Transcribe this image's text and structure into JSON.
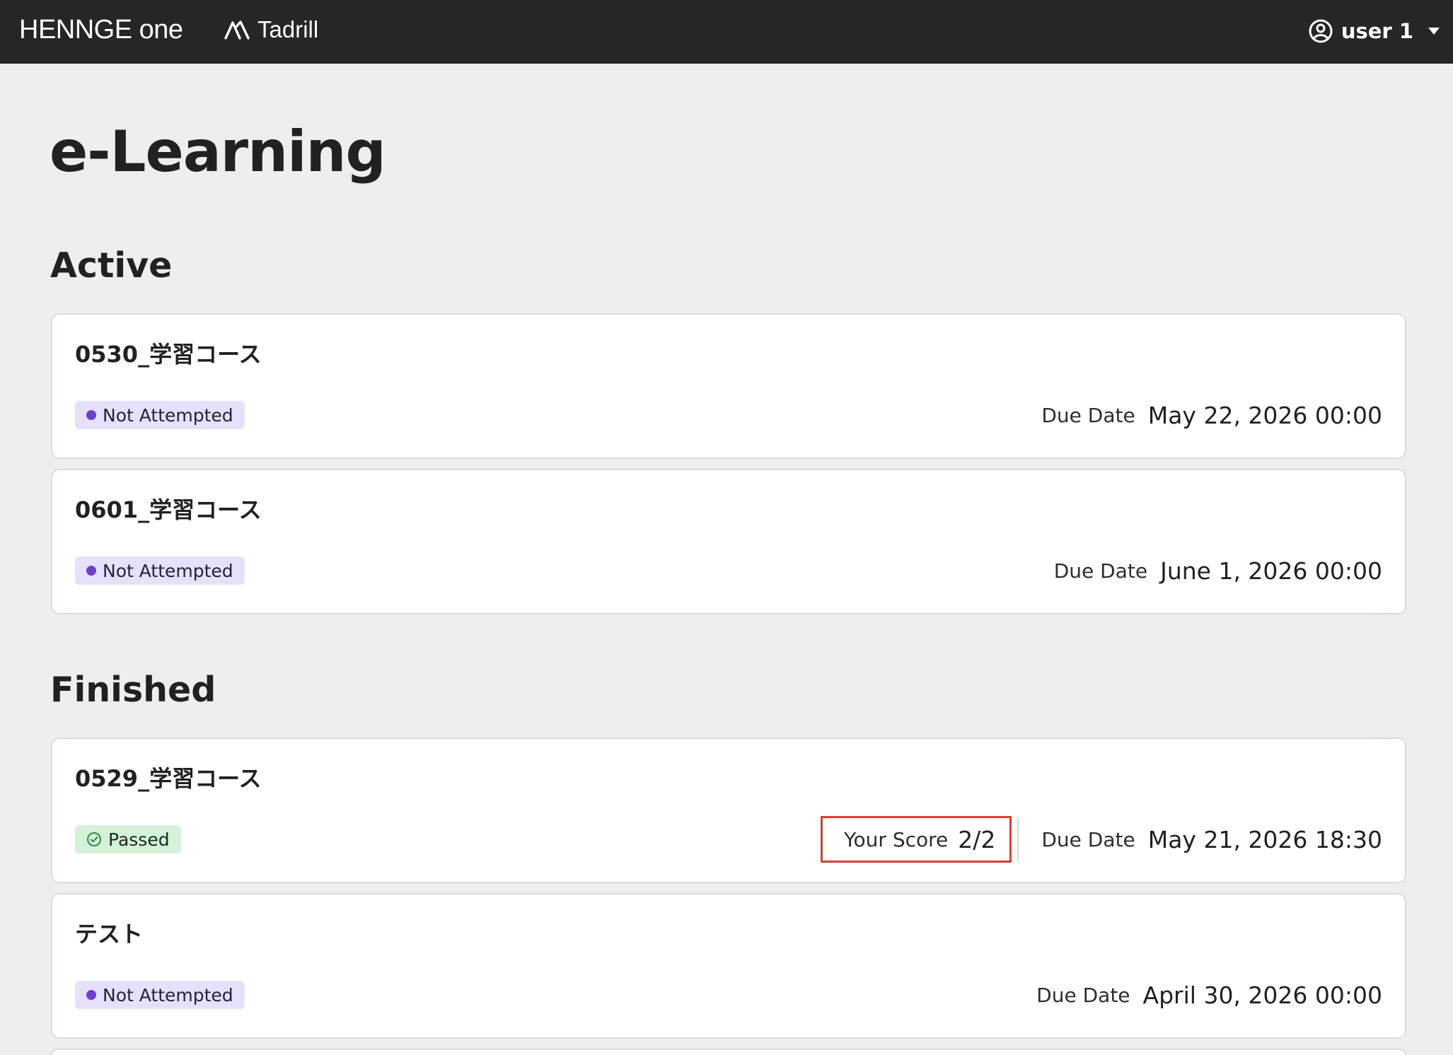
{
  "header": {
    "brand": "HENNGE one",
    "product": "Tadrill",
    "user_name": "user 1"
  },
  "page_title": "e-Learning",
  "sections": {
    "active": {
      "title": "Active",
      "courses": [
        {
          "title": "0530_学習コース",
          "status": "Not Attempted",
          "due_label": "Due Date",
          "due_value": "May 22, 2026 00:00"
        },
        {
          "title": "0601_学習コース",
          "status": "Not Attempted",
          "due_label": "Due Date",
          "due_value": "June 1, 2026 00:00"
        }
      ]
    },
    "finished": {
      "title": "Finished",
      "courses": [
        {
          "title": "0529_学習コース",
          "status": "Passed",
          "score_label": "Your Score",
          "score_value": "2/2",
          "due_label": "Due Date",
          "due_value": "May 21, 2026 18:30"
        },
        {
          "title": "テスト",
          "status": "Not Attempted",
          "due_label": "Due Date",
          "due_value": "April 30, 2026 00:00"
        }
      ]
    }
  },
  "colors": {
    "topbar": "#242628",
    "background": "#eceff1",
    "not_attempted_badge": "#e6e1fb",
    "not_attempted_dot": "#6c3fd0",
    "passed_badge": "#d3f2d8",
    "passed_icon": "#2e8b45",
    "score_highlight": "#d9412e"
  },
  "icons": {
    "product_logo": "tadrill-logo-icon",
    "user": "user-circle-icon",
    "menu": "caret-down-icon",
    "passed": "check-circle-icon",
    "not_attempted": "status-dot-icon"
  }
}
